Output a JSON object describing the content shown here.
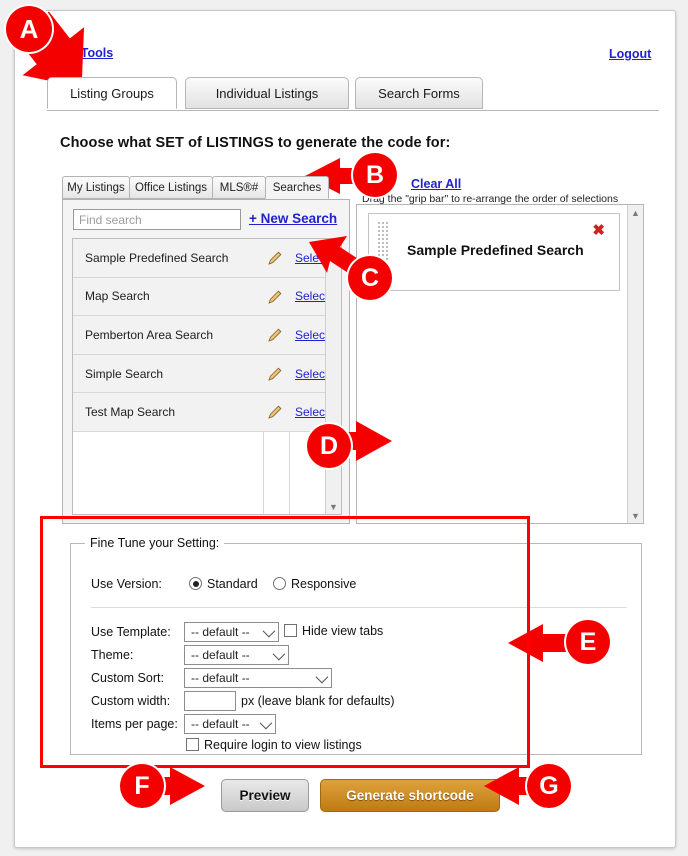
{
  "window": {
    "background_color": "#f0f0f0",
    "card_background": "#ffffff"
  },
  "header": {
    "tools_link": "ng Tools",
    "logout_link": "Logout"
  },
  "primary_tabs": [
    {
      "label": "Listing Groups",
      "active": true
    },
    {
      "label": "Individual Listings",
      "active": false
    },
    {
      "label": "Search Forms",
      "active": false
    }
  ],
  "heading": "Choose what SET of LISTINGS to generate the code for:",
  "sub_tabs": [
    {
      "label": "My Listings",
      "active": false
    },
    {
      "label": "Office Listings",
      "active": false
    },
    {
      "label": "MLS®#",
      "active": false
    },
    {
      "label": "Searches",
      "active": true
    }
  ],
  "left_panel": {
    "search_placeholder": "Find search",
    "search_value": "",
    "new_search_link": "+ New Search",
    "select_link_label": "Select »",
    "rows": [
      {
        "name": "Sample Predefined Search"
      },
      {
        "name": "Map Search"
      },
      {
        "name": "Pemberton Area Search"
      },
      {
        "name": "Simple Search"
      },
      {
        "name": "Test Map Search"
      }
    ]
  },
  "right_panel": {
    "clear_all_link": "Clear All",
    "grip_note": "Drag the \"grip bar\" to re-arrange the order of selections",
    "selected": [
      {
        "title": "Sample Predefined Search",
        "remove_glyph": "✖"
      }
    ]
  },
  "fine_tune": {
    "legend": "Fine Tune your Setting:",
    "use_version_label": "Use Version:",
    "version_options": [
      {
        "label": "Standard",
        "selected": true
      },
      {
        "label": "Responsive",
        "selected": false
      }
    ],
    "use_template_label": "Use Template:",
    "use_template_value": "-- default --",
    "hide_view_tabs_label": "Hide view tabs",
    "hide_view_tabs_checked": false,
    "theme_label": "Theme:",
    "theme_value": "-- default --",
    "custom_sort_label": "Custom Sort:",
    "custom_sort_value": "-- default --",
    "custom_width_label": "Custom width:",
    "custom_width_value": "",
    "custom_width_suffix": "px (leave blank for defaults)",
    "items_per_page_label": "Items per page:",
    "items_per_page_value": "-- default --",
    "require_login_label": "Require login to view listings",
    "require_login_checked": false
  },
  "buttons": {
    "preview": "Preview",
    "generate": "Generate shortcode"
  },
  "annotations": {
    "color": "#f50000",
    "markers": [
      {
        "letter": "A"
      },
      {
        "letter": "B"
      },
      {
        "letter": "C"
      },
      {
        "letter": "D"
      },
      {
        "letter": "E"
      },
      {
        "letter": "F"
      },
      {
        "letter": "G"
      }
    ]
  }
}
